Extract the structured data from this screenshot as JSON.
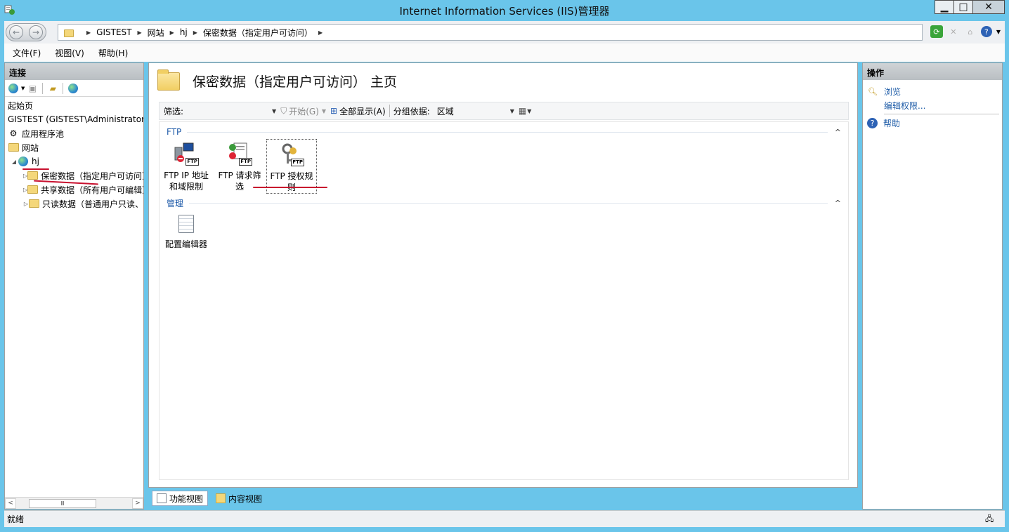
{
  "window": {
    "title": "Internet Information Services (IIS)管理器",
    "minimize_glyph": "▁",
    "maximize_glyph": "□",
    "close_glyph": "✕"
  },
  "address": {
    "crumbs": [
      "GISTEST",
      "网站",
      "hj",
      "保密数据（指定用户可访问）"
    ]
  },
  "menu": [
    "文件(F)",
    "视图(V)",
    "帮助(H)"
  ],
  "connections": {
    "title": "连接",
    "tree": {
      "start_page": "起始页",
      "server": "GISTEST (GISTEST\\Administrator)",
      "app_pools": "应用程序池",
      "sites": "网站",
      "site_hj": "hj",
      "folders": [
        "保密数据（指定用户可访问）",
        "共享数据（所有用户可编辑）",
        "只读数据（普通用户只读、"
      ]
    },
    "scroll_glyph": "Ⅲ"
  },
  "main": {
    "page_title": "保密数据（指定用户可访问） 主页",
    "filter": {
      "label": "筛选:",
      "go_label": "开始(G)",
      "show_all_label": "全部显示(A)",
      "group_label": "分组依据:",
      "group_value": "区域"
    },
    "sections": [
      {
        "name": "FTP",
        "features": [
          "FTP IP 地址和域限制",
          "FTP 请求筛选",
          "FTP 授权规则"
        ]
      },
      {
        "name": "管理",
        "features": [
          "配置编辑器"
        ]
      }
    ],
    "selected_feature": "FTP 授权规则",
    "ftp_badge": "FTP"
  },
  "view_tabs": [
    "功能视图",
    "内容视图"
  ],
  "actions": {
    "title": "操作",
    "items": [
      "浏览",
      "编辑权限...",
      "帮助"
    ]
  },
  "status": {
    "text": "就绪"
  },
  "colors": {
    "titlebar": "#6ac5ea",
    "link": "#1f5da8",
    "annotation": "#c8102e"
  }
}
